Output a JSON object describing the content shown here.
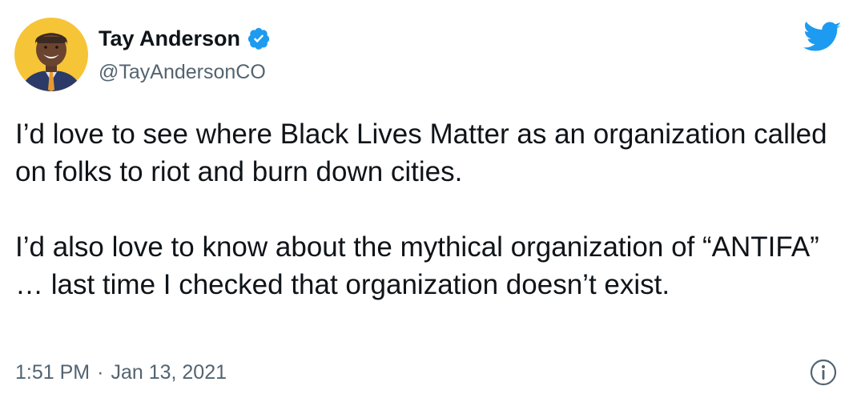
{
  "author": {
    "display_name": "Tay Anderson",
    "handle": "@TayAndersonCO",
    "verified": true,
    "avatar_icon": "profile-photo",
    "avatar_bg": "#f6c437"
  },
  "tweet": {
    "paragraphs": [
      "I’d love to see where Black Lives Matter as an organization called on folks to riot and burn down cities.",
      "I’d also love to know about the mythical organization of “ANTIFA” … last time I checked that organization doesn’t exist."
    ],
    "time": "1:51 PM",
    "separator": "·",
    "date": "Jan 13, 2021"
  },
  "icons": {
    "brand": "twitter-bird-icon",
    "verified": "verified-badge-icon",
    "info": "info-icon"
  },
  "colors": {
    "twitter_blue": "#1d9bf0",
    "text_primary": "#0f1419",
    "text_secondary": "#536471"
  }
}
